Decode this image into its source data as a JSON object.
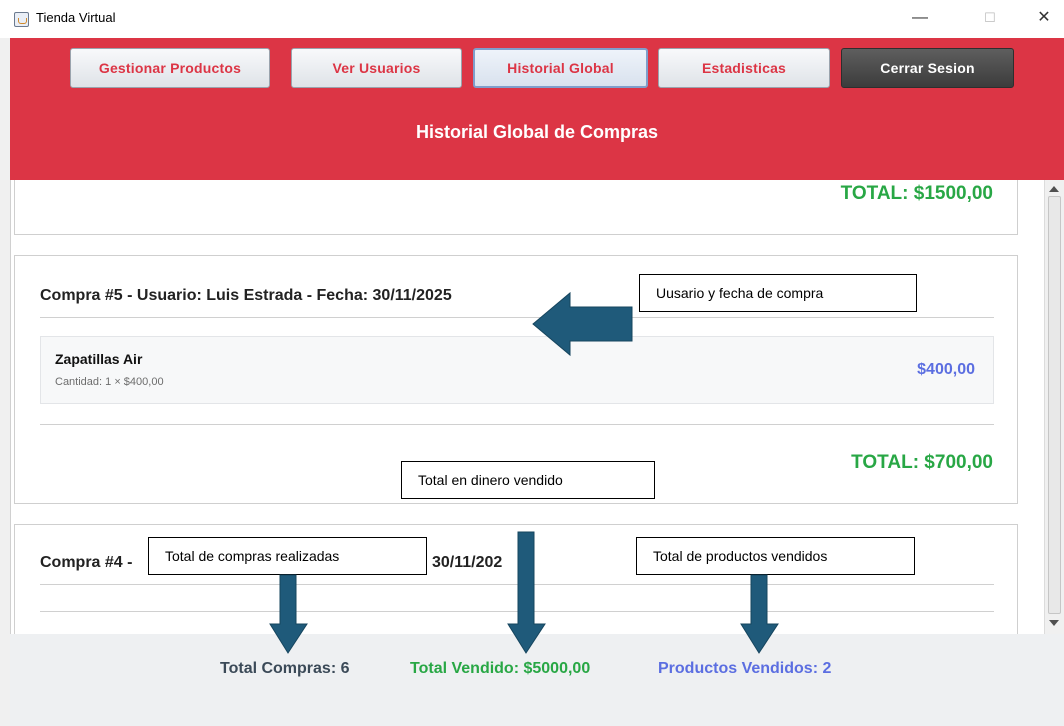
{
  "window": {
    "title": "Tienda Virtual",
    "controls": {
      "minimize": "—",
      "maximize": "☐",
      "close": "✕"
    }
  },
  "header": {
    "nav": [
      {
        "label": "Gestionar Productos"
      },
      {
        "label": "Ver Usuarios"
      },
      {
        "label": "Historial Global",
        "active": true
      },
      {
        "label": "Estadisticas"
      },
      {
        "label": "Cerrar Sesion"
      }
    ],
    "title": "Historial Global de Compras"
  },
  "purchases": {
    "prev_total": "TOTAL: $1500,00",
    "compra5": {
      "title": "Compra #5 - Usuario: Luis Estrada - Fecha: 30/11/2025",
      "items": [
        {
          "name": "Zapatillas Air",
          "quantity": "Cantidad: 1 × $400,00",
          "price": "$400,00"
        }
      ],
      "total": "TOTAL: $700,00"
    },
    "compra4": {
      "title_start": "Compra #4 -",
      "title_end": "30/11/202"
    }
  },
  "summary": {
    "total_compras": "Total Compras: 6",
    "total_vendido": "Total Vendido: $5000,00",
    "productos_vendidos": "Productos Vendidos: 2"
  },
  "annotations": {
    "usuario_fecha": "Uusario y fecha de compra",
    "total_dinero": "Total en dinero vendido",
    "total_compras": "Total de compras realizadas",
    "total_productos": "Total de productos vendidos"
  },
  "colors": {
    "header_red": "#dc3545",
    "total_green": "#28a745",
    "price_blue": "#5b6ee1",
    "arrow_blue": "#1f5a7a"
  },
  "icons": {
    "app": "java-coffee-cup-icon",
    "scroll_up": "arrow-up-icon",
    "scroll_down": "arrow-down-icon"
  }
}
